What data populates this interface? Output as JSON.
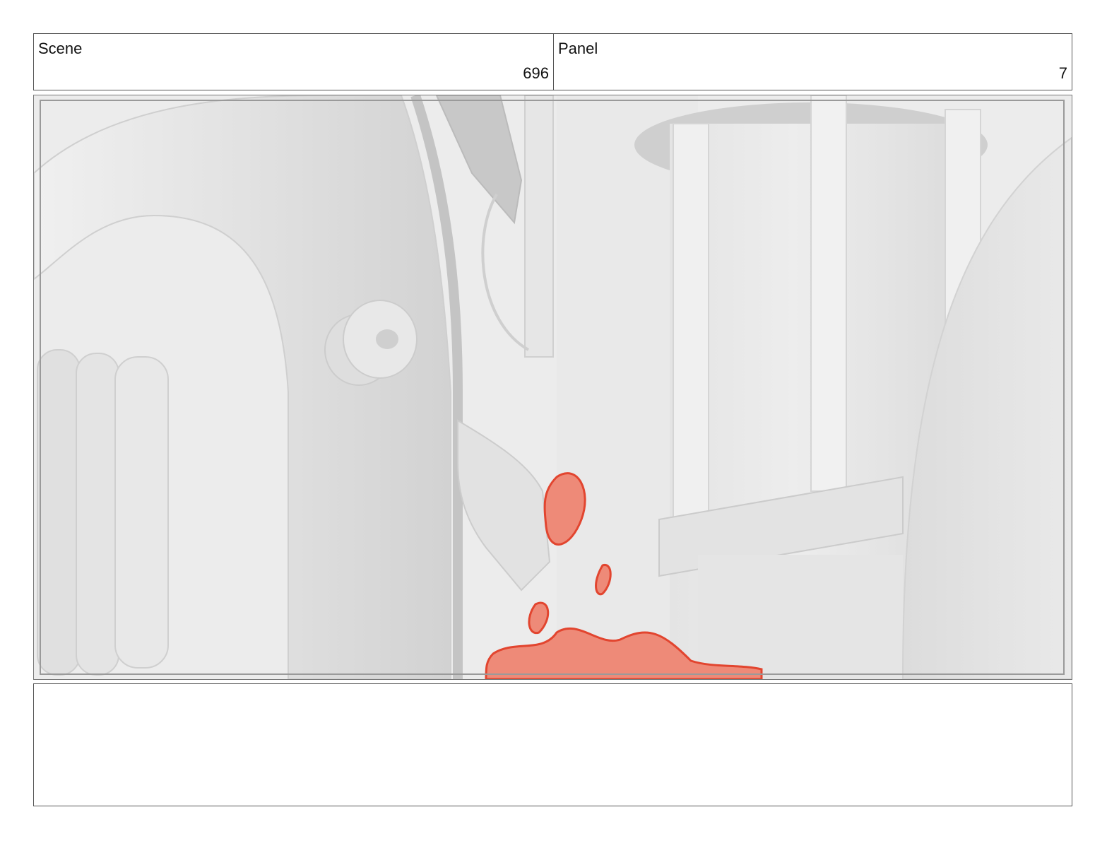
{
  "header": {
    "scene": {
      "label": "Scene",
      "value": "696"
    },
    "panel": {
      "label": "Panel",
      "value": "7"
    }
  },
  "frame": {
    "palette": {
      "background": "#ececec",
      "pipe_light": "#e6e6e6",
      "pipe_mid": "#d8d8d8",
      "pipe_dark": "#c9c9c9",
      "liquid": "#ee8a78",
      "liquid_edge": "#e2452f"
    }
  },
  "notes": {
    "text": ""
  }
}
